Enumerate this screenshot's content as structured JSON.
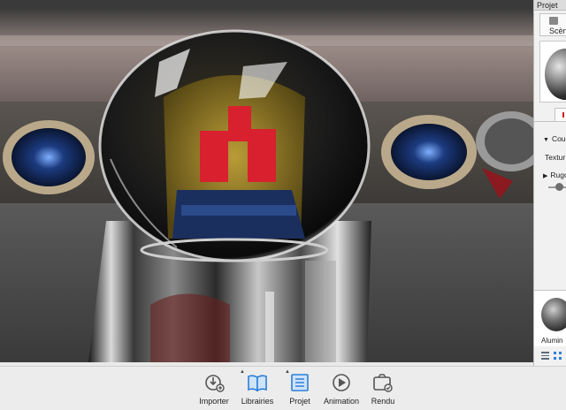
{
  "panel": {
    "header_title": "Projet",
    "scene_tab": "Scène",
    "section_couleur": "Cou",
    "texture_label": "Textur",
    "rugosite_label": "Rugo",
    "library_item_label": "Alumin"
  },
  "toolbar": {
    "importer": "Importer",
    "librairies": "Librairies",
    "projet": "Projet",
    "animation": "Animation",
    "rendu": "Rendu"
  },
  "colors": {
    "accent": "#2d7fd8",
    "toolbar_bg": "#ececec"
  }
}
